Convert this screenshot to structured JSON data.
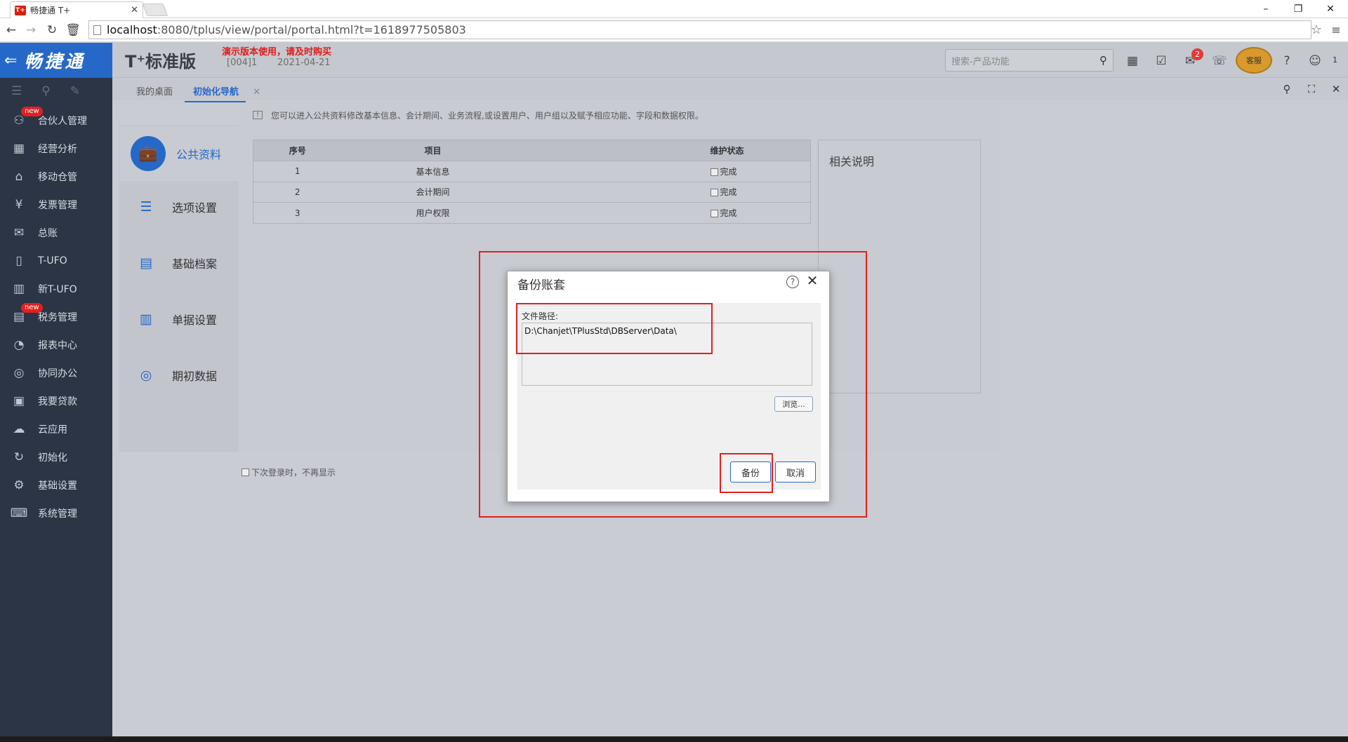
{
  "browser": {
    "tab_title": "畅捷通 T+",
    "tab_favicon": "T+",
    "url_host": "localhost",
    "url_rest": ":8080/tplus/view/portal/portal.html?t=1618977505803",
    "minimize": "–",
    "restore": "❐",
    "close": "✕"
  },
  "header": {
    "brand": "畅捷通",
    "product": "T⁺标准版",
    "demo_notice": "演示版本使用，请及时购买",
    "account_code": "[004]1",
    "account_date": "2021-04-21",
    "search_placeholder": "搜索-产品功能",
    "notification_count": "2",
    "service_label": "客服",
    "user_suffix": "1"
  },
  "sidebar": {
    "items": [
      {
        "label": "合伙人管理",
        "icon": "partner-icon",
        "badge": "new"
      },
      {
        "label": "经营分析",
        "icon": "analysis-icon"
      },
      {
        "label": "移动仓管",
        "icon": "warehouse-icon"
      },
      {
        "label": "发票管理",
        "icon": "invoice-icon"
      },
      {
        "label": "总账",
        "icon": "ledger-icon"
      },
      {
        "label": "T-UFO",
        "icon": "ufo-icon"
      },
      {
        "label": "新T-UFO",
        "icon": "new-ufo-icon"
      },
      {
        "label": "税务管理",
        "icon": "tax-icon",
        "badge": "new"
      },
      {
        "label": "报表中心",
        "icon": "report-icon"
      },
      {
        "label": "协同办公",
        "icon": "collab-icon"
      },
      {
        "label": "我要贷款",
        "icon": "loan-icon"
      },
      {
        "label": "云应用",
        "icon": "cloud-icon"
      },
      {
        "label": "初始化",
        "icon": "init-icon"
      },
      {
        "label": "基础设置",
        "icon": "settings-icon"
      },
      {
        "label": "系统管理",
        "icon": "system-icon"
      }
    ]
  },
  "tabs": {
    "desktop": "我的桌面",
    "init_nav": "初始化导航",
    "close": "✕"
  },
  "main": {
    "info": "您可以进入公共资料修改基本信息、会计期间、业务流程,或设置用户、用户组以及赋予相应功能、字段和数据权限。",
    "left_nav": {
      "active": "公共资料",
      "items": [
        "选项设置",
        "基础档案",
        "单据设置",
        "期初数据"
      ]
    },
    "table": {
      "headers": [
        "序号",
        "项目",
        "维护状态"
      ],
      "rows": [
        {
          "no": "1",
          "item": "基本信息",
          "status": "完成"
        },
        {
          "no": "2",
          "item": "会计期间",
          "status": "完成"
        },
        {
          "no": "3",
          "item": "用户权限",
          "status": "完成"
        }
      ]
    },
    "related_title": "相关说明",
    "no_show": "下次登录时，不再显示"
  },
  "dialog": {
    "title": "备份账套",
    "help": "?",
    "close": "✕",
    "path_label": "文件路径:",
    "path_value": "D:\\Chanjet\\TPlusStd\\DBServer\\Data\\",
    "browse": "浏览...",
    "backup": "备份",
    "cancel": "取消"
  },
  "colors": {
    "brand_blue": "#2668c8",
    "sidebar_bg": "#2b3546",
    "highlight_red": "#e02020"
  }
}
